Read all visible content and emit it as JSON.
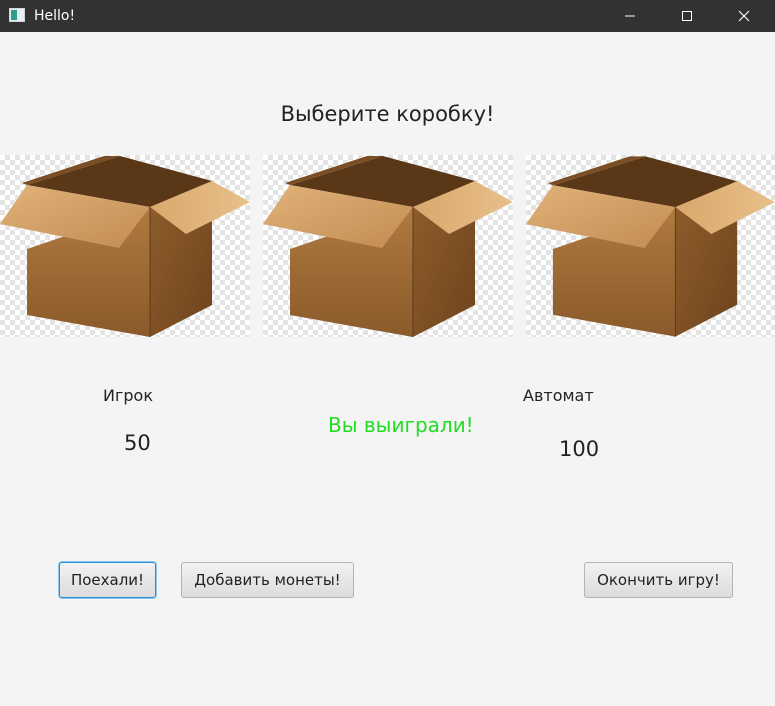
{
  "window": {
    "title": "Hello!",
    "app_icon": "java-app-icon"
  },
  "heading": "Выберите коробку!",
  "boxes": [
    {
      "id": "box-1",
      "icon": "cardboard-box"
    },
    {
      "id": "box-2",
      "icon": "cardboard-box"
    },
    {
      "id": "box-3",
      "icon": "cardboard-box"
    }
  ],
  "player": {
    "label": "Игрок",
    "score": "50"
  },
  "machine": {
    "label": "Автомат",
    "score": "100"
  },
  "result": {
    "text": "Вы выиграли!",
    "color": "#22dd22"
  },
  "buttons": {
    "go": "Поехали!",
    "add_coins": "Добавить монеты!",
    "finish": "Окончить игру!"
  },
  "colors": {
    "titlebar": "#323232",
    "background": "#f4f4f4",
    "focus": "#2b8fd6"
  }
}
